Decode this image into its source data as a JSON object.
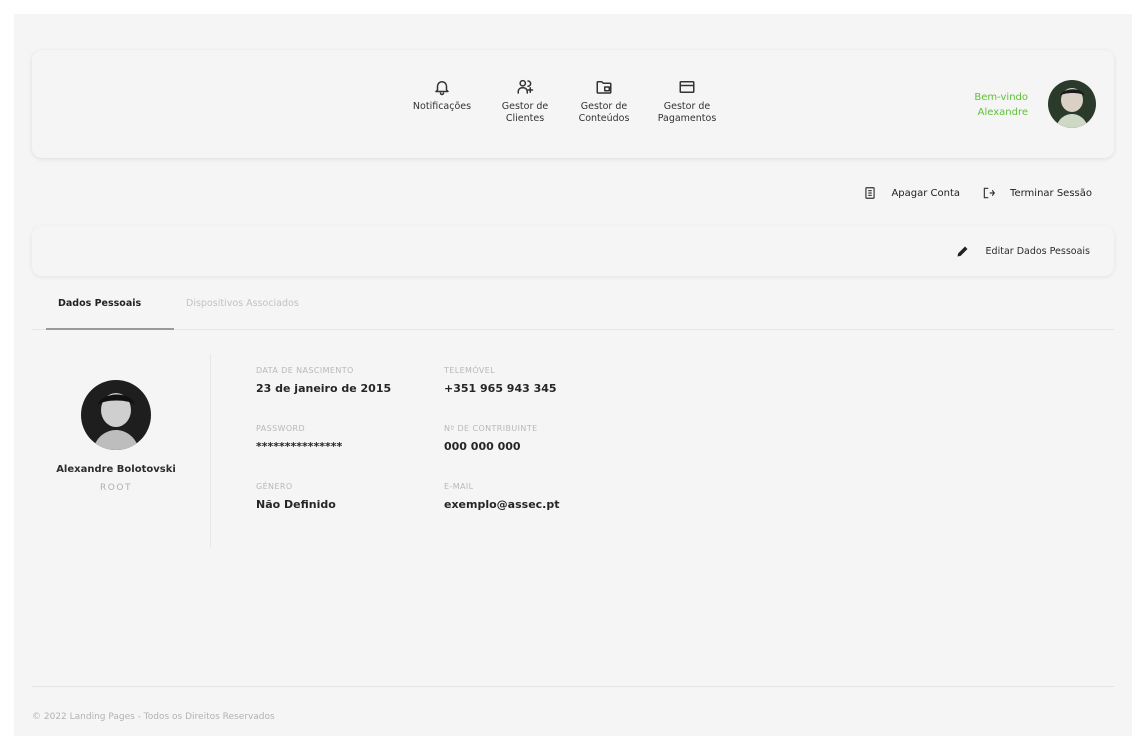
{
  "header": {
    "nav": [
      {
        "label": "Notificações",
        "icon": "bell-icon"
      },
      {
        "label": "Gestor de\nClientes",
        "icon": "users-icon"
      },
      {
        "label": "Gestor de\nConteúdos",
        "icon": "folder-icon"
      },
      {
        "label": "Gestor de\nPagamentos",
        "icon": "credit-card-icon"
      }
    ],
    "welcome_line1": "Bem-vindo",
    "welcome_line2": "Alexandre"
  },
  "actions": {
    "delete_account": "Apagar Conta",
    "logout": "Terminar Sessão"
  },
  "edit_button": "Editar Dados Pessoais",
  "tabs": {
    "personal": "Dados Pessoais",
    "devices": "Dispositivos Associados"
  },
  "profile": {
    "name": "Alexandre Bolotovski",
    "role": "ROOT"
  },
  "fields": {
    "birth_label": "DATA DE NASCIMENTO",
    "birth_value": "23 de janeiro de 2015",
    "phone_label": "TELEMÓVEL",
    "phone_value": "+351 965 943 345",
    "password_label": "PASSWORD",
    "password_value": "***************",
    "nif_label": "Nº DE CONTRIBUINTE",
    "nif_value": "000 000 000",
    "gender_label": "GÉNERO",
    "gender_value": "Não Definido",
    "email_label": "E-MAIL",
    "email_value": "exemplo@assec.pt"
  },
  "footer": "© 2022 Landing Pages - Todos os Direitos Reservados",
  "colors": {
    "accent_green": "#5fbf3a",
    "background": "#f5f5f5"
  }
}
